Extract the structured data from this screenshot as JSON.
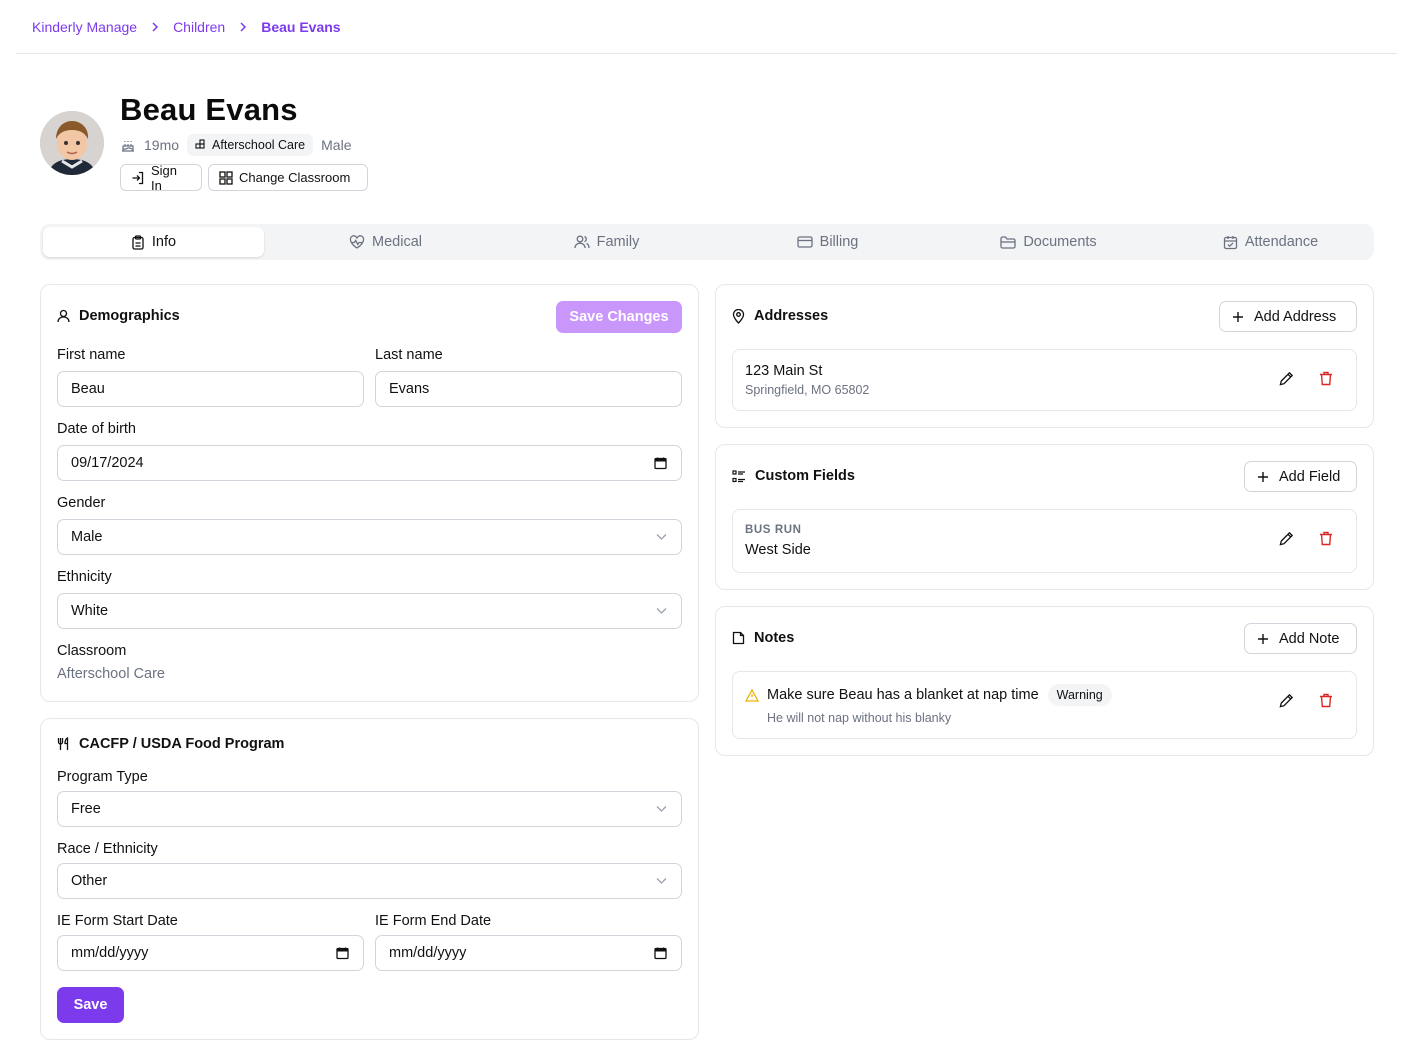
{
  "breadcrumb": {
    "items": [
      "Kinderly Manage",
      "Children"
    ],
    "current": "Beau Evans"
  },
  "child": {
    "name": "Beau Evans",
    "age": "19mo",
    "program_badge": "Afterschool Care",
    "gender": "Male"
  },
  "actions": {
    "sign_in": "Sign In",
    "change_classroom": "Change Classroom"
  },
  "tabs": [
    {
      "label": "Info",
      "icon": "clipboard-icon",
      "active": true
    },
    {
      "label": "Medical",
      "icon": "heart-pulse-icon",
      "active": false
    },
    {
      "label": "Family",
      "icon": "users-icon",
      "active": false
    },
    {
      "label": "Billing",
      "icon": "credit-card-icon",
      "active": false
    },
    {
      "label": "Documents",
      "icon": "folder-icon",
      "active": false
    },
    {
      "label": "Attendance",
      "icon": "calendar-check-icon",
      "active": false
    }
  ],
  "demographics": {
    "title": "Demographics",
    "save_label": "Save Changes",
    "first_name_label": "First name",
    "first_name": "Beau",
    "last_name_label": "Last name",
    "last_name": "Evans",
    "dob_label": "Date of birth",
    "dob": "09/17/2024",
    "gender_label": "Gender",
    "gender": "Male",
    "ethnicity_label": "Ethnicity",
    "ethnicity": "White",
    "classroom_label": "Classroom",
    "classroom": "Afterschool Care"
  },
  "cacfp": {
    "title": "CACFP / USDA Food Program",
    "program_type_label": "Program Type",
    "program_type": "Free",
    "race_label": "Race / Ethnicity",
    "race": "Other",
    "ie_start_label": "IE Form Start Date",
    "ie_start_placeholder": "mm/dd/yyyy",
    "ie_end_label": "IE Form End Date",
    "ie_end_placeholder": "mm/dd/yyyy",
    "save_label": "Save"
  },
  "addresses": {
    "title": "Addresses",
    "add_label": "Add Address",
    "items": [
      {
        "line1": "123 Main St",
        "line2": "Springfield, MO 65802"
      }
    ]
  },
  "custom_fields": {
    "title": "Custom Fields",
    "add_label": "Add Field",
    "items": [
      {
        "key": "BUS RUN",
        "value": "West Side"
      }
    ]
  },
  "notes": {
    "title": "Notes",
    "add_label": "Add Note",
    "items": [
      {
        "title": "Make sure Beau has a blanket at nap time",
        "badge": "Warning",
        "body": "He will not nap without his blanky"
      }
    ]
  },
  "colors": {
    "accent": "#7c3aed",
    "accent_light": "#c084fc",
    "danger": "#dc2626",
    "warning": "#eab308"
  }
}
